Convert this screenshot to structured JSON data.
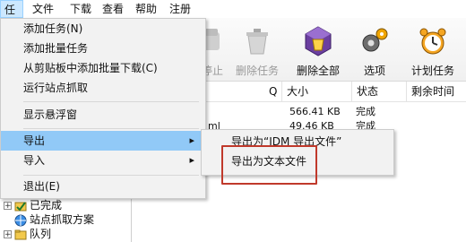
{
  "menubar": {
    "items": [
      "任务",
      "文件",
      "下载",
      "查看",
      "帮助",
      "注册"
    ]
  },
  "toolbar": {
    "buttons": [
      {
        "label": "停止",
        "icon": "stop-icon",
        "enabled": false
      },
      {
        "label": "删除任务",
        "icon": "delete-task-icon",
        "enabled": false
      },
      {
        "label": "删除全部",
        "icon": "delete-all-icon",
        "enabled": true
      },
      {
        "label": "选项",
        "icon": "options-gear-icon",
        "enabled": true
      },
      {
        "label": "计划任务",
        "icon": "scheduler-clock-icon",
        "enabled": true
      }
    ]
  },
  "task_menu": {
    "items": [
      {
        "label": "添加任务(N)"
      },
      {
        "label": "添加批量任务"
      },
      {
        "label": "从剪贴板中添加批量下载(C)"
      },
      {
        "label": "运行站点抓取"
      },
      {
        "label": "显示悬浮窗"
      },
      {
        "label": "导出",
        "submenu": true
      },
      {
        "label": "导入",
        "submenu": true
      },
      {
        "label": "退出(E)"
      }
    ]
  },
  "export_submenu": {
    "items": [
      {
        "label": "导出为“IDM 导出文件”"
      },
      {
        "label": "导出为文本文件"
      }
    ]
  },
  "list": {
    "columns": [
      "Q",
      "大小",
      "状态",
      "剩余时间"
    ],
    "rows": [
      {
        "name_tail": "",
        "size": "566.41 KB",
        "status": "完成"
      },
      {
        "name_tail": "ml",
        "size": "49.46 KB",
        "status": "完成"
      }
    ]
  },
  "tree": {
    "items": [
      {
        "label": "已完成",
        "expander": "+"
      },
      {
        "label": "站点抓取方案",
        "expander": ""
      },
      {
        "label": "队列",
        "expander": "+"
      }
    ]
  },
  "colors": {
    "menu_hover": "#91c9f7",
    "highlight_box": "#c0392b",
    "menubar_active": "#cce8ff"
  }
}
